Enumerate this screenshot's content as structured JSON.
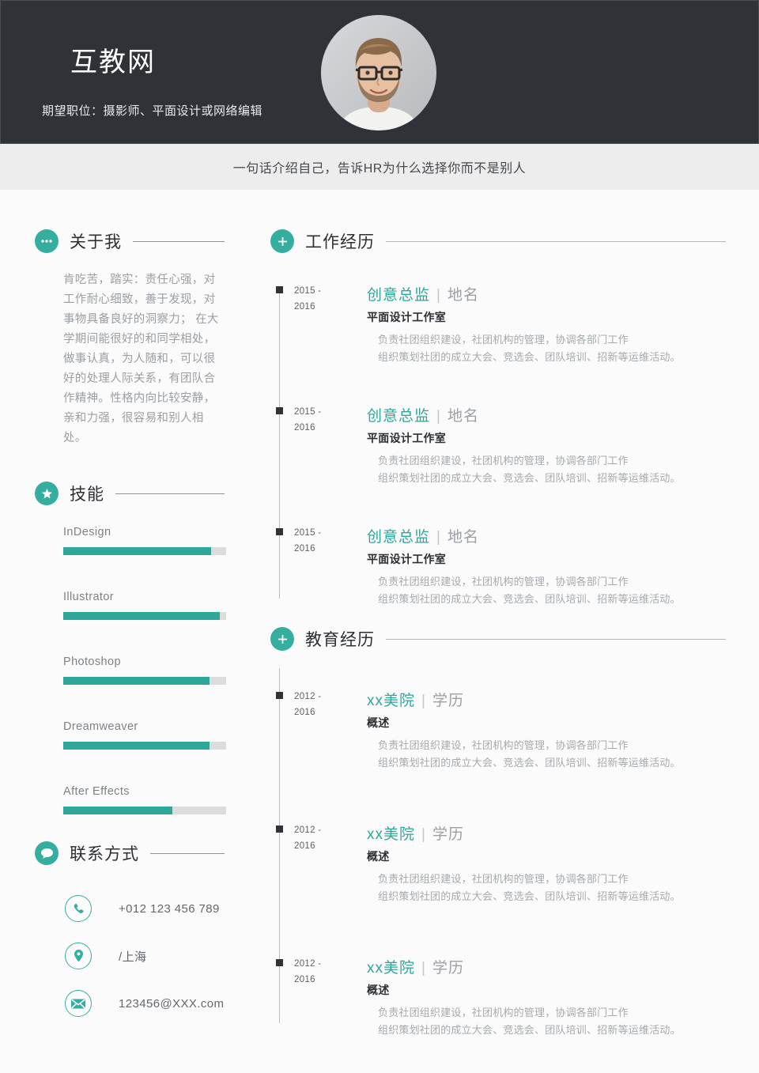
{
  "header": {
    "name": "互教网",
    "role": "期望职位：摄影师、平面设计或网络编辑",
    "avatar_alt": "portrait-photo"
  },
  "tagline": "一句话介绍自己，告诉HR为什么选择你而不是别人",
  "accent_color": "#2ea69a",
  "dark_color": "#2f3337",
  "about": {
    "title": "关于我",
    "icon": "ellipsis-icon",
    "text": "肯吃苦，踏实：责任心强，对工作耐心细致，善于发现，对事物具备良好的洞察力；\n在大学期间能很好的和同学相处，做事认真，为人随和，可以很好的处理人际关系，有团队合作精神。性格内向比较安静，亲和力强，很容易和别人相处。"
  },
  "skills": {
    "title": "技能",
    "icon": "star-icon",
    "items": [
      {
        "name": "InDesign",
        "value": 91
      },
      {
        "name": "Illustrator",
        "value": 96
      },
      {
        "name": "Photoshop",
        "value": 90
      },
      {
        "name": "Dreamweaver",
        "value": 90
      },
      {
        "name": "After Effects",
        "value": 67
      }
    ]
  },
  "contact": {
    "title": "联系方式",
    "icon": "chat-bubble-icon",
    "items": [
      {
        "icon": "phone-icon",
        "text": "+012 123 456 789"
      },
      {
        "icon": "location-pin-icon",
        "text": "/上海"
      },
      {
        "icon": "envelope-icon",
        "text": "123456@XXX.com"
      }
    ]
  },
  "work": {
    "title": "工作经历",
    "icon": "plus-icon",
    "entries": [
      {
        "date_from": "2015 -",
        "date_to": "2016",
        "role": "创意总监",
        "place": "地名",
        "org": "平面设计工作室",
        "desc_line1": "负责社团组织建设，社团机构的管理，协调各部门工作",
        "desc_line2": "组织策划社团的成立大会、竞选会、团队培训、招新等运维活动。"
      },
      {
        "date_from": "2015 -",
        "date_to": "2016",
        "role": "创意总监",
        "place": "地名",
        "org": "平面设计工作室",
        "desc_line1": "负责社团组织建设，社团机构的管理，协调各部门工作",
        "desc_line2": "组织策划社团的成立大会、竞选会、团队培训、招新等运维活动。"
      },
      {
        "date_from": "2015 -",
        "date_to": "2016",
        "role": "创意总监",
        "place": "地名",
        "org": "平面设计工作室",
        "desc_line1": "负责社团组织建设，社团机构的管理，协调各部门工作",
        "desc_line2": "组织策划社团的成立大会、竞选会、团队培训、招新等运维活动。"
      }
    ]
  },
  "education": {
    "title": "教育经历",
    "icon": "plus-icon",
    "entries": [
      {
        "date_from": "2012 -",
        "date_to": "2016",
        "school": "xx美院",
        "degree": "学历",
        "org": "概述",
        "desc_line1": "负责社团组织建设，社团机构的管理，协调各部门工作",
        "desc_line2": "组织策划社团的成立大会、竞选会、团队培训、招新等运维活动。"
      },
      {
        "date_from": "2012 -",
        "date_to": "2016",
        "school": "xx美院",
        "degree": "学历",
        "org": "概述",
        "desc_line1": "负责社团组织建设，社团机构的管理，协调各部门工作",
        "desc_line2": "组织策划社团的成立大会、竞选会、团队培训、招新等运维活动。"
      },
      {
        "date_from": "2012 -",
        "date_to": "2016",
        "school": "xx美院",
        "degree": "学历",
        "org": "概述",
        "desc_line1": "负责社团组织建设，社团机构的管理，协调各部门工作",
        "desc_line2": "组织策划社团的成立大会、竞选会、团队培训、招新等运维活动。"
      }
    ]
  }
}
